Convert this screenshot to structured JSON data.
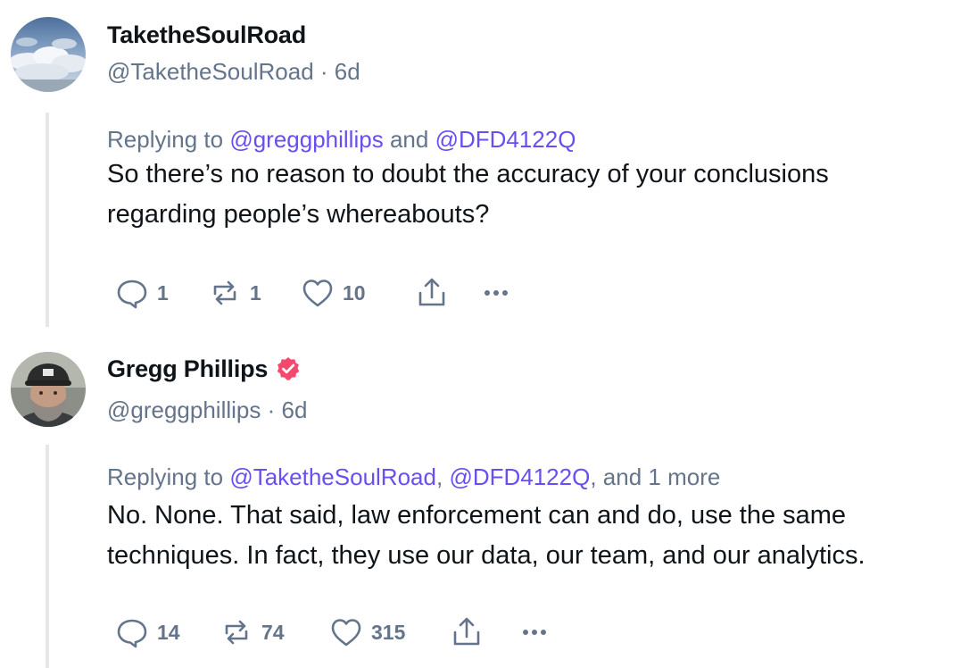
{
  "posts": [
    {
      "author": {
        "display_name": "TaketheSoulRoad",
        "handle": "@TaketheSoulRoad",
        "time": "6d",
        "verified": false
      },
      "reply": {
        "prefix": "Replying to",
        "mention_1": "@greggphillips",
        "separator": "and",
        "mention_2": "@DFD4122Q"
      },
      "text_line_1": "So there’s no reason to doubt the accuracy of your conclusions",
      "text_line_2": "regarding people’s whereabouts?",
      "actions": {
        "replies": "1",
        "reposts": "1",
        "likes": "10"
      }
    },
    {
      "author": {
        "display_name": "Gregg Phillips",
        "handle": "@greggphillips",
        "time": "6d",
        "verified": true
      },
      "reply": {
        "prefix": "Replying to",
        "mention_1": "@TaketheSoulRoad",
        "sep_1": ",",
        "mention_2": "@DFD4122Q",
        "sep_2": ", and 1 more"
      },
      "text_line_1": "No. None. That said, law enforcement can and do, use the same",
      "text_line_2": "techniques. In fact, they use our data, our team, and our analytics.",
      "actions": {
        "replies": "14",
        "reposts": "74",
        "likes": "315"
      }
    }
  ],
  "separator_dot": "·",
  "colors": {
    "mention": "#6b4ef2",
    "muted": "#64748b",
    "verified_badge": "#f2496d",
    "thread_line": "#e5e7eb"
  },
  "icons": [
    "reply-icon",
    "repost-icon",
    "like-icon",
    "share-icon",
    "more-icon",
    "verified-badge-icon"
  ]
}
